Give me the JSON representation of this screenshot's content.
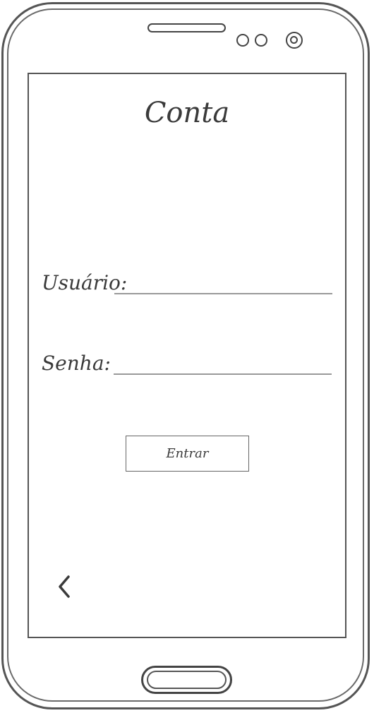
{
  "screen": {
    "title": "Conta",
    "form": {
      "username_label": "Usuário:",
      "username_value": "",
      "password_label": "Senha:",
      "password_value": "",
      "submit_label": "Entrar"
    },
    "nav": {
      "back_icon": "chevron-left-icon"
    }
  },
  "colors": {
    "stroke": "#444444",
    "text": "#3a3a3a",
    "field_line": "#999999",
    "background": "#ffffff"
  }
}
